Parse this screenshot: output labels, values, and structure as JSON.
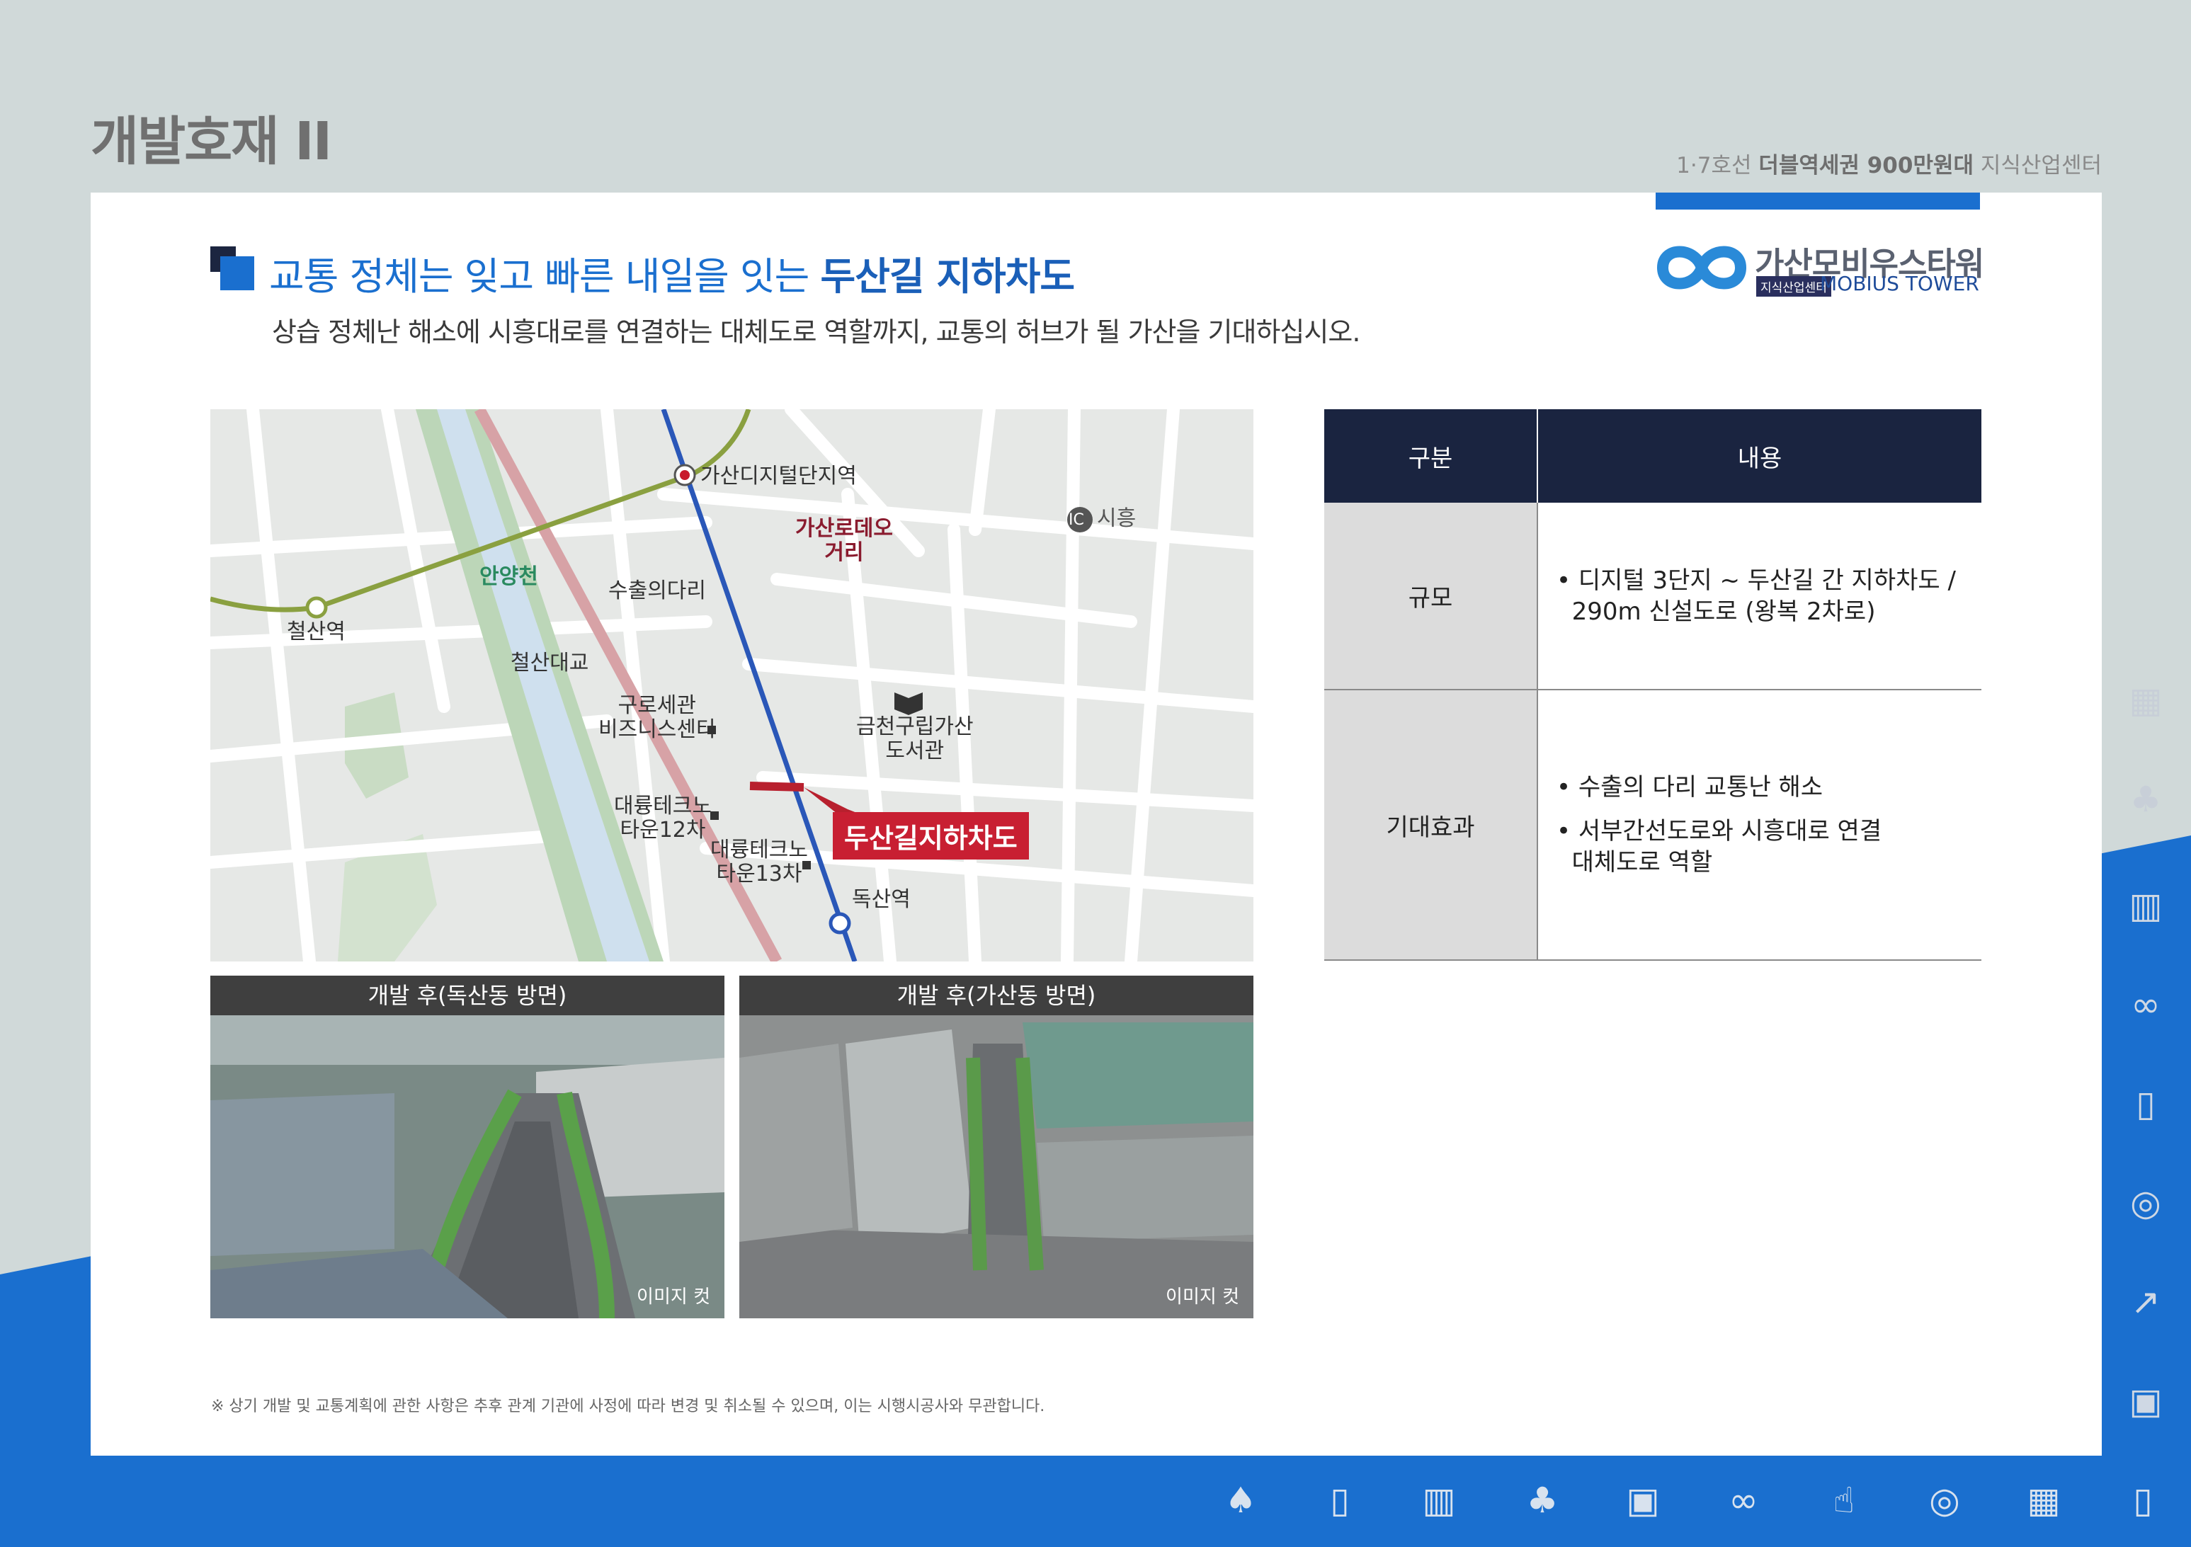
{
  "header": {
    "title": "개발호재 II",
    "sub_prefix": "1·7호선 ",
    "sub_bold": "더블역세권 900만원대",
    "sub_suffix": " 지식산업센터"
  },
  "logo": {
    "name_ko": "가산모비우스타워",
    "tag": "지식산업센터",
    "name_en": "MOBIUS TOWER"
  },
  "section": {
    "heading_prefix": "교통 정체는 잊고 빠른 내일을 잇는 ",
    "heading_bold": "두산길 지하차도",
    "subheading": "상습 정체난 해소에 시흥대로를 연결하는 대체도로 역할까지, 교통의 허브가 될 가산을 기대하십시오."
  },
  "map": {
    "labels": {
      "gasan_station": "가산디지털단지역",
      "gasan_rodeo": "가산로데오\n거리",
      "ic": "IC",
      "siheung": "시흥",
      "anyangcheon": "안양천",
      "suchul_bridge": "수출의다리",
      "cheolsan_station": "철산역",
      "cheolsan_bridge": "철산대교",
      "guro_customs": "구로세관\n비즈니스센터",
      "library": "금천구립가산\n도서관",
      "techno12": "대륭테크노\n타운12차",
      "techno13": "대륭테크노\n타운13차",
      "doksan_station": "독산역",
      "callout": "두산길지하차도"
    }
  },
  "photos": [
    {
      "title": "개발 후(독산동 방면)",
      "caption": "이미지 컷"
    },
    {
      "title": "개발 후(가산동 방면)",
      "caption": "이미지 컷"
    }
  ],
  "table": {
    "headers": [
      "구분",
      "내용"
    ],
    "rows": [
      {
        "key": "규모",
        "items": [
          "• 디지털 3단지 ~ 두산길 간 지하차도 /\n  290m 신설도로 (왕복 2차로)"
        ]
      },
      {
        "key": "기대효과",
        "items": [
          "• 수출의 다리 교통난 해소",
          "• 서부간선도로와 시흥대로 연결\n  대체도로 역할"
        ]
      }
    ]
  },
  "footnote": "※ 상기 개발 및 교통계획에 관한 사항은 추후 관계 기관에 사정에 따라 변경 및 취소될 수 있으며, 이는 시행시공사와 무관합니다.",
  "colors": {
    "brand_blue": "#1a6fcf",
    "navy": "#1a2440",
    "callout_red": "#c81f32"
  }
}
